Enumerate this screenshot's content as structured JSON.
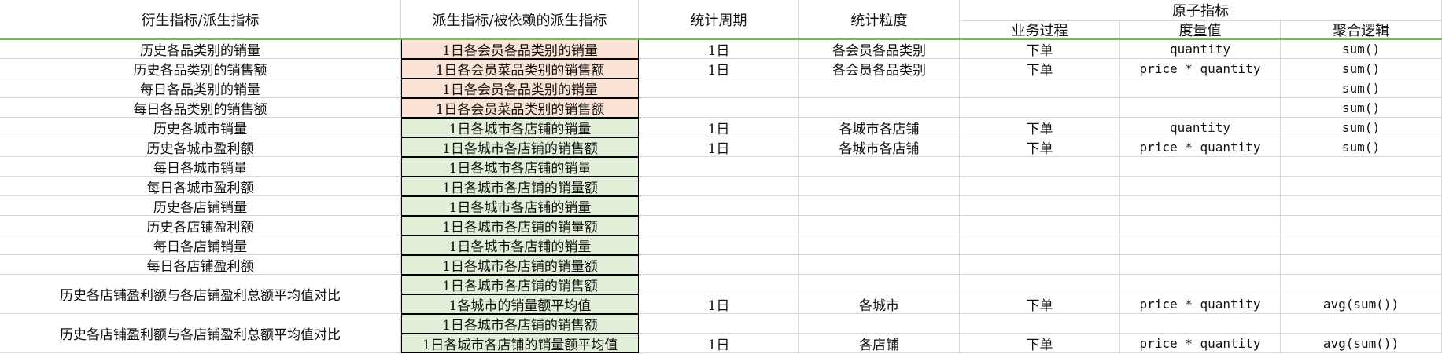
{
  "headers": {
    "derived": "衍生指标/派生指标",
    "dependency": "派生指标/被依赖的派生指标",
    "period": "统计周期",
    "granularity": "统计粒度",
    "atomic": "原子指标",
    "business": "业务过程",
    "measure": "度量值",
    "aggregation": "聚合逻辑"
  },
  "rows": [
    {
      "derived": "历史各品类别的销量",
      "dependency": "1日各会员各品类别的销量",
      "fill": "orange",
      "period": "1日",
      "granularity": "各会员各品类别",
      "business": "下单",
      "measure": "quantity",
      "agg": "sum()"
    },
    {
      "derived": "历史各品类别的销售额",
      "dependency": "1日各会员菜品类别的销售额",
      "fill": "orange",
      "period": "1日",
      "granularity": "各会员各品类别",
      "business": "下单",
      "measure": "price * quantity",
      "agg": "sum()"
    },
    {
      "derived": "每日各品类别的销量",
      "dependency": "1日各会员各品类别的销量",
      "fill": "orange",
      "period": "",
      "granularity": "",
      "business": "",
      "measure": "",
      "agg": "sum()"
    },
    {
      "derived": "每日各品类别的销售额",
      "dependency": "1日各会员菜品类别的销售额",
      "fill": "orange",
      "period": "",
      "granularity": "",
      "business": "",
      "measure": "",
      "agg": "sum()"
    },
    {
      "derived": "历史各城市销量",
      "dependency": "1日各城市各店铺的销量",
      "fill": "green",
      "period": "1日",
      "granularity": "各城市各店铺",
      "business": "下单",
      "measure": "quantity",
      "agg": "sum()"
    },
    {
      "derived": "历史各城市盈利额",
      "dependency": "1日各城市各店铺的销售额",
      "fill": "green",
      "period": "1日",
      "granularity": "各城市各店铺",
      "business": "下单",
      "measure": "price * quantity",
      "agg": "sum()"
    },
    {
      "derived": "每日各城市销量",
      "dependency": "1日各城市各店铺的销量",
      "fill": "green",
      "period": "",
      "granularity": "",
      "business": "",
      "measure": "",
      "agg": ""
    },
    {
      "derived": "每日各城市盈利额",
      "dependency": "1日各城市各店铺的销量额",
      "fill": "green",
      "period": "",
      "granularity": "",
      "business": "",
      "measure": "",
      "agg": ""
    },
    {
      "derived": "历史各店铺销量",
      "dependency": "1日各城市各店铺的销量",
      "fill": "green",
      "period": "",
      "granularity": "",
      "business": "",
      "measure": "",
      "agg": ""
    },
    {
      "derived": "历史各店铺盈利额",
      "dependency": "1日各城市各店铺的销量额",
      "fill": "green",
      "period": "",
      "granularity": "",
      "business": "",
      "measure": "",
      "agg": ""
    },
    {
      "derived": "每日各店铺销量",
      "dependency": "1日各城市各店铺的销量",
      "fill": "green",
      "period": "",
      "granularity": "",
      "business": "",
      "measure": "",
      "agg": ""
    },
    {
      "derived": "每日各店铺盈利额",
      "dependency": "1日各城市各店铺的销量额",
      "fill": "green",
      "period": "",
      "granularity": "",
      "business": "",
      "measure": "",
      "agg": ""
    }
  ],
  "groups": [
    {
      "derived": "历史各店铺盈利额与各店铺盈利总额平均值对比",
      "subrows": [
        {
          "dependency": "1日各城市各店铺的销售额",
          "period": "",
          "granularity": "",
          "business": "",
          "measure": "",
          "agg": ""
        },
        {
          "dependency": "1各城市的销量额平均值",
          "period": "1日",
          "granularity": "各城市",
          "business": "下单",
          "measure": "price * quantity",
          "agg": "avg(sum())"
        }
      ]
    },
    {
      "derived": "历史各店铺盈利额与各店铺盈利总额平均值对比",
      "subrows": [
        {
          "dependency": "1日各城市各店铺的销售额",
          "period": "",
          "granularity": "",
          "business": "",
          "measure": "",
          "agg": ""
        },
        {
          "dependency": "1日各城市各店铺的销量额平均值",
          "period": "1日",
          "granularity": "各店铺",
          "business": "下单",
          "measure": "price * quantity",
          "agg": "avg(sum())"
        }
      ]
    }
  ]
}
